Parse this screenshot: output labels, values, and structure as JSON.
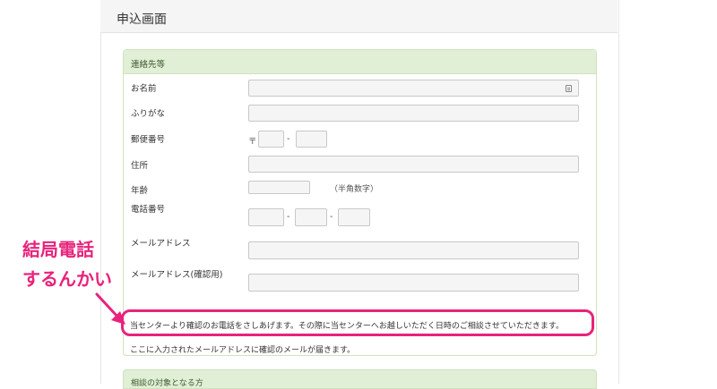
{
  "page": {
    "title": "申込画面"
  },
  "contact_section": {
    "heading": "連絡先等",
    "fields": {
      "name": {
        "label": "お名前"
      },
      "furigana": {
        "label": "ふりがな"
      },
      "postal": {
        "label": "郵便番号",
        "prefix": "〒",
        "separator": "-"
      },
      "address": {
        "label": "住所"
      },
      "age": {
        "label": "年齢",
        "hint": "（半角数字）"
      },
      "phone": {
        "label": "電話番号",
        "separator": "-"
      },
      "email": {
        "label": "メールアドレス"
      },
      "email_confirm": {
        "label": "メールアドレス(確認用)"
      }
    },
    "notes": [
      "当センターより確認のお電話をさしあげます。その際に当センターへお越しいただく日時のご相談させていただきます。",
      "ここに入力されたメールアドレスに確認のメールが届きます。"
    ]
  },
  "annotation": {
    "line1": "結局電話",
    "line2": "するんかい"
  },
  "next_section": {
    "heading": "相談の対象となる方"
  },
  "colors": {
    "annotation": "#e8237b",
    "panel_heading_bg": "#e0efd6",
    "panel_border": "#cfe3be"
  }
}
